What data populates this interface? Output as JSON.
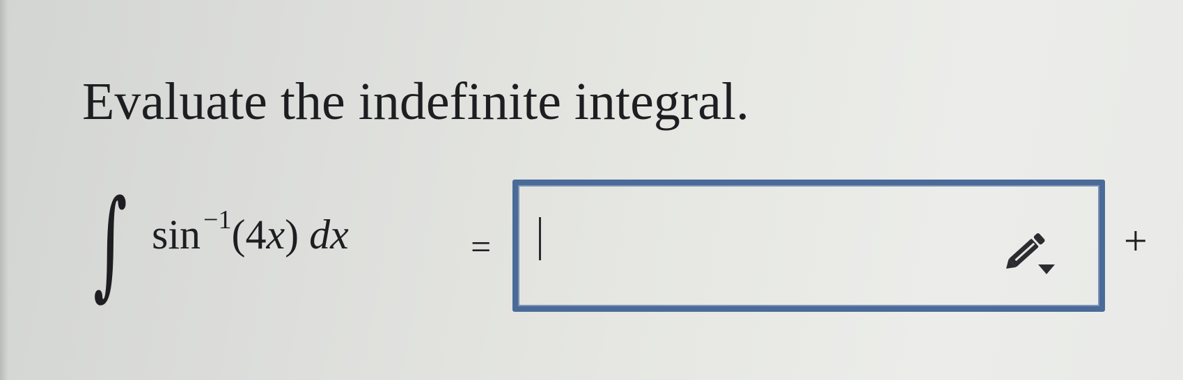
{
  "question": {
    "prompt": "Evaluate the indefinite integral."
  },
  "integral": {
    "sign": "∫",
    "function": "sin",
    "exponent": "−1",
    "argument_open": "(4",
    "argument_var": "x",
    "argument_close": ")",
    "differential": "dx",
    "equals": "="
  },
  "answer": {
    "value": "",
    "editor_icon": "pencil-dropdown-icon",
    "border_color": "#4a6a98"
  },
  "constant": {
    "text": "+"
  }
}
